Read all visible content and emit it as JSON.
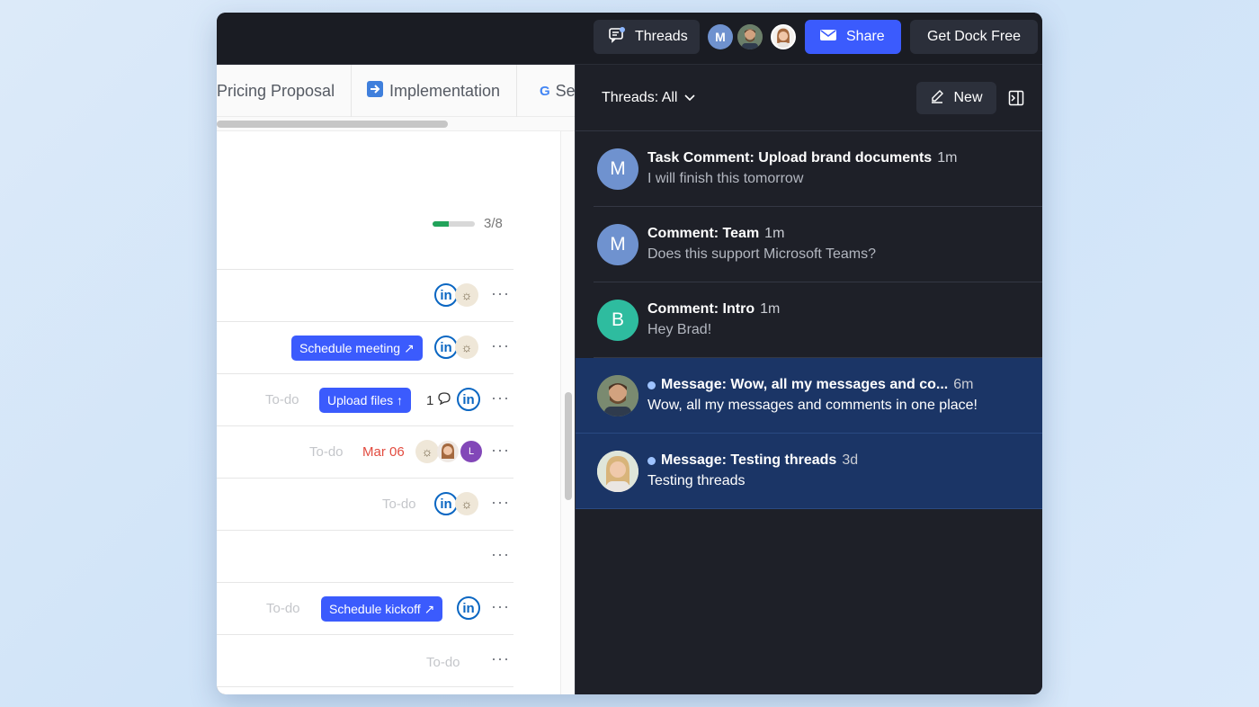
{
  "topbar": {
    "threads_label": "Threads",
    "share_label": "Share",
    "dock_label": "Get Dock Free",
    "avatar_m": "M"
  },
  "tabs": [
    {
      "label": "Pricing Proposal"
    },
    {
      "label": "Implementation"
    },
    {
      "label": "Se"
    }
  ],
  "progress": {
    "text": "3/8",
    "fraction": 0.375
  },
  "rows": [
    {
      "more": "···"
    },
    {
      "pill": "Schedule meeting ↗",
      "more": "···"
    },
    {
      "todo": "To-do",
      "pill": "Upload files ↑",
      "comments": "1",
      "more": "···"
    },
    {
      "todo": "To-do",
      "date": "Mar 06",
      "avatar": "L",
      "more": "···"
    },
    {
      "todo": "To-do",
      "more": "···"
    },
    {
      "more": "···"
    },
    {
      "todo": "To-do",
      "pill": "Schedule kickoff ↗",
      "more": "···"
    },
    {
      "todo": "To-do",
      "more": "···"
    }
  ],
  "threads_panel": {
    "filter_label": "Threads: All",
    "new_label": "New",
    "items": [
      {
        "avatar": "M",
        "title": "Task Comment: Upload brand documents",
        "time": "1m",
        "preview": "I will finish this tomorrow"
      },
      {
        "avatar": "M",
        "title": "Comment: Team",
        "time": "1m",
        "preview": "Does this support Microsoft Teams?"
      },
      {
        "avatar": "B",
        "title": "Comment: Intro",
        "time": "1m",
        "preview": "Hey Brad!"
      },
      {
        "avatar": "",
        "title": "Message: Wow, all my messages and co...",
        "time": "6m",
        "preview": "Wow, all my messages and comments in one place!"
      },
      {
        "avatar": "",
        "title": "Message: Testing threads",
        "time": "3d",
        "preview": "Testing threads"
      }
    ]
  },
  "colors": {
    "accent": "#3b5bfd",
    "unread_bg": "#1b3566",
    "progress": "#22a35a",
    "date": "#e24b3f"
  }
}
